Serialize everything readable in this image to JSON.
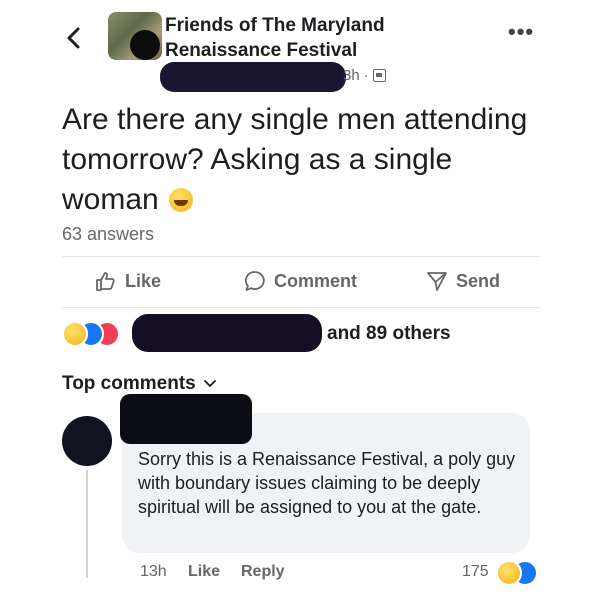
{
  "post": {
    "group_name": "Friends of The Maryland Renaissance Festival",
    "timestamp": "3h",
    "text": "Are there any single men attending tomorrow? Asking as a single woman",
    "emoji": "laughing-emoji",
    "answers_count": "63 answers"
  },
  "actions": {
    "like_label": "Like",
    "comment_label": "Comment",
    "send_label": "Send"
  },
  "reactions": {
    "icons": [
      "laughing-emoji",
      "like-reaction",
      "love-reaction"
    ],
    "others_text": "and 89 others"
  },
  "top_comments_label": "Top comments",
  "comment": {
    "text": "Sorry this is a Renaissance Festival, a poly guy with boundary issues claiming to be deeply spiritual will be assigned to you at the gate.",
    "time": "13h",
    "like_label": "Like",
    "reply_label": "Reply",
    "reaction_count": "175",
    "reaction_icons": [
      "laughing-emoji",
      "like-reaction"
    ]
  },
  "colors": {
    "like_blue": "#1877f2",
    "love_red": "#f33e58",
    "meta_gray": "#65676b",
    "bubble_bg": "#f0f2f5"
  }
}
